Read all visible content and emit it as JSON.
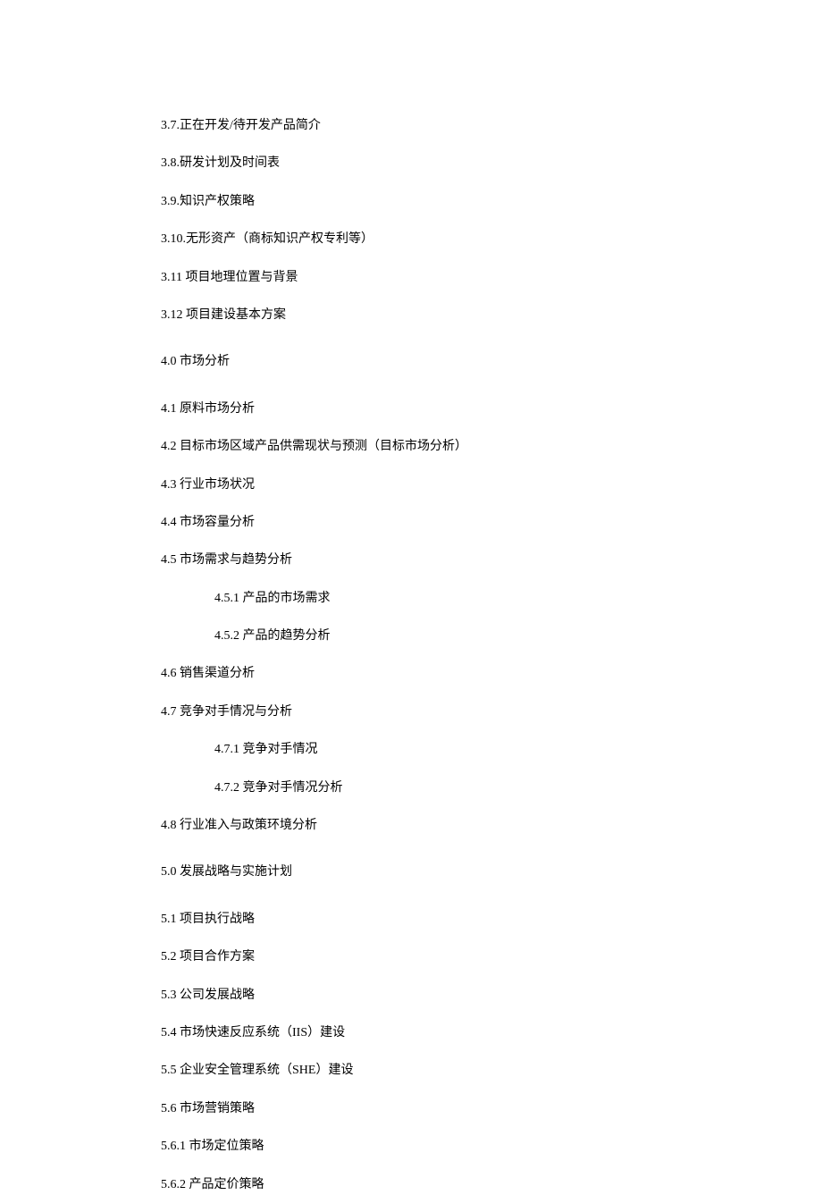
{
  "items": [
    {
      "level": 2,
      "text": "3.7.正在开发/待开发产品简介"
    },
    {
      "level": 2,
      "text": "3.8.研发计划及时间表"
    },
    {
      "level": 2,
      "text": "3.9.知识产权策略"
    },
    {
      "level": 2,
      "text": "3.10.无形资产（商标知识产权专利等）"
    },
    {
      "level": 2,
      "text": "3.11 项目地理位置与背景"
    },
    {
      "level": 2,
      "text": "3.12 项目建设基本方案"
    },
    {
      "level": 1,
      "text": "4.0 市场分析"
    },
    {
      "level": 2,
      "text": "4.1 原料市场分析"
    },
    {
      "level": 2,
      "text": "4.2 目标市场区域产品供需现状与预测（目标市场分析）"
    },
    {
      "level": 2,
      "text": "4.3 行业市场状况"
    },
    {
      "level": 2,
      "text": "4.4 市场容量分析"
    },
    {
      "level": 2,
      "text": "4.5 市场需求与趋势分析"
    },
    {
      "level": 3,
      "text": "4.5.1 产品的市场需求"
    },
    {
      "level": 3,
      "text": "4.5.2 产品的趋势分析"
    },
    {
      "level": 2,
      "text": "4.6 销售渠道分析"
    },
    {
      "level": 2,
      "text": "4.7 竞争对手情况与分析"
    },
    {
      "level": 3,
      "text": "4.7.1 竞争对手情况"
    },
    {
      "level": 3,
      "text": "4.7.2 竞争对手情况分析"
    },
    {
      "level": 2,
      "text": "4.8 行业准入与政策环境分析"
    },
    {
      "level": 1,
      "text": "5.0 发展战略与实施计划"
    },
    {
      "level": 2,
      "text": "5.1 项目执行战略"
    },
    {
      "level": 2,
      "text": "5.2 项目合作方案"
    },
    {
      "level": 2,
      "text": "5.3 公司发展战略"
    },
    {
      "level": 2,
      "text": "5.4 市场快速反应系统（IIS）建设"
    },
    {
      "level": 2,
      "text": "5.5 企业安全管理系统（SHE）建设"
    },
    {
      "level": 2,
      "text": "5.6 市场营销策略"
    },
    {
      "level": 2,
      "text": "5.6.1 市场定位策略"
    },
    {
      "level": 2,
      "text": "5.6.2 产品定价策略"
    }
  ]
}
